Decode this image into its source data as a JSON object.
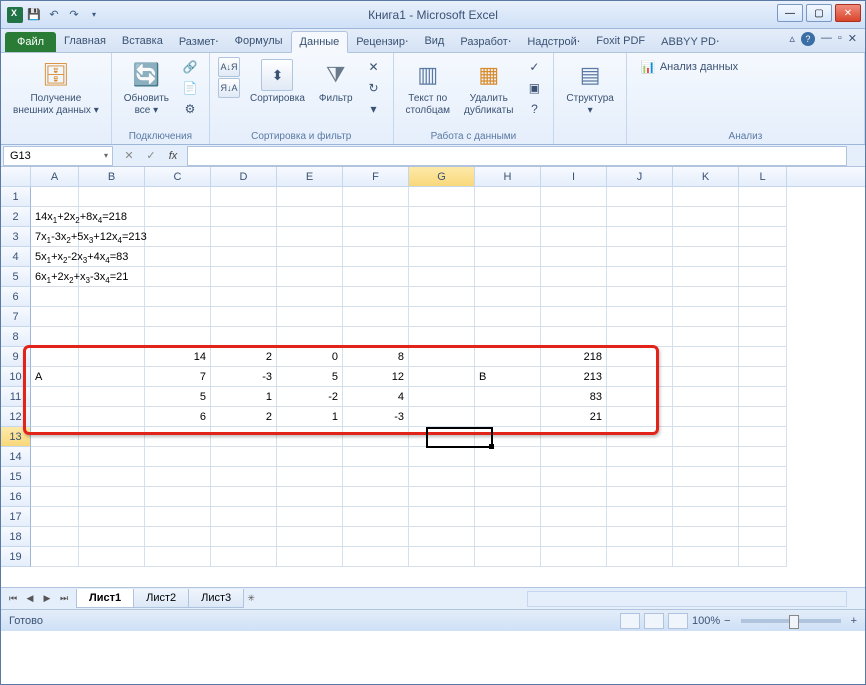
{
  "title": "Книга1 - Microsoft Excel",
  "qat": {
    "save_tip": "Сохранить",
    "undo_tip": "Отменить",
    "redo_tip": "Вернуть"
  },
  "tabs": {
    "file": "Файл",
    "list": [
      "Главная",
      "Вставка",
      "Размет⋅",
      "Формулы",
      "Данные",
      "Рецензир⋅",
      "Вид",
      "Разработ⋅",
      "Надстрой⋅",
      "Foxit PDF",
      "ABBYY PD⋅"
    ],
    "active_index": 4
  },
  "ribbon": {
    "ext_data": "Получение\nвнешних данных ▾",
    "refresh": "Обновить\nвсе ▾",
    "connections_label": "Подключения",
    "sort_asc": "А↓Я",
    "sort_desc": "Я↓А",
    "sort": "Сортировка",
    "filter": "Фильтр",
    "sortfilter_label": "Сортировка и фильтр",
    "text_cols": "Текст по\nстолбцам",
    "remove_dup": "Удалить\nдубликаты",
    "datawork_label": "Работа с данными",
    "structure": "Структура\n▾",
    "analysis": "Анализ данных",
    "analysis_label": "Анализ"
  },
  "namebox": "G13",
  "fx_label": "fx",
  "columns": [
    "A",
    "B",
    "C",
    "D",
    "E",
    "F",
    "G",
    "H",
    "I",
    "J",
    "K",
    "L"
  ],
  "selected_col": "G",
  "selected_row": 13,
  "rows_count": 19,
  "formulas": {
    "r2": "14x₁+2x₂+8x₄=218",
    "r3": "7x₁-3x₂+5x₃+12x₄=213",
    "r4": "5x₁+x₂-2x₃+4x₄=83",
    "r5": "6x₁+2x₂+x₃-3x₄=21"
  },
  "matrix": {
    "label_A": "A",
    "label_B": "B",
    "rows": [
      {
        "c": "14",
        "d": "2",
        "e": "0",
        "f": "8",
        "i": "218"
      },
      {
        "c": "7",
        "d": "-3",
        "e": "5",
        "f": "12",
        "i": "213"
      },
      {
        "c": "5",
        "d": "1",
        "e": "-2",
        "f": "4",
        "i": "83"
      },
      {
        "c": "6",
        "d": "2",
        "e": "1",
        "f": "-3",
        "i": "21"
      }
    ]
  },
  "sheets": {
    "list": [
      "Лист1",
      "Лист2",
      "Лист3"
    ],
    "active": 0
  },
  "status": "Готово",
  "zoom": "100%"
}
